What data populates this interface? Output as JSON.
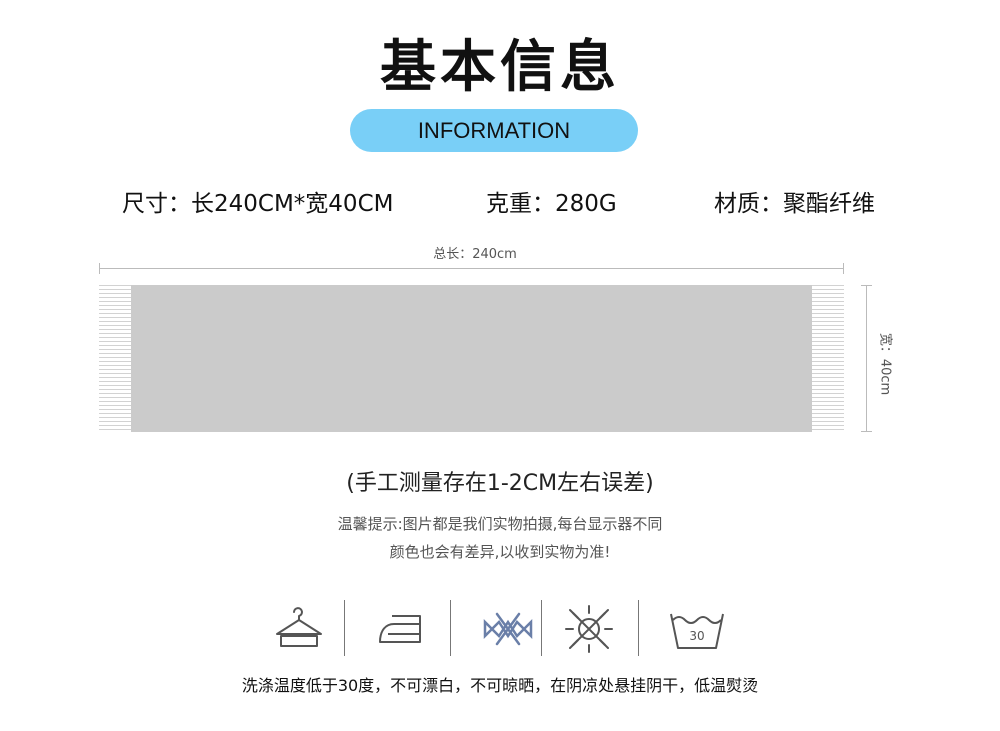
{
  "header": {
    "title": "基本信息",
    "subtitle": "INFORMATION",
    "pill_color": "#79cff7"
  },
  "specs": {
    "size": "尺寸：长240CM*宽40CM",
    "weight": "克重：280G",
    "material": "材质：聚酯纤维"
  },
  "diagram": {
    "length_label": "总长：240cm",
    "width_label": "宽：40cm"
  },
  "notes": {
    "measurement": "(手工测量存在1-2CM左右误差)",
    "tip_line1": "温馨提示:图片都是我们实物拍摄,每台显示器不同",
    "tip_line2": "颜色也会有差异,以收到实物为准!"
  },
  "care": {
    "icons": [
      "hanger-icon",
      "iron-icon",
      "no-wring-icon",
      "no-sun-icon",
      "wash-30-icon"
    ],
    "wash_temp_label": "30",
    "instructions": "洗涤温度低于30度，不可漂白，不可晾晒，在阴凉处悬挂阴干，低温熨烫"
  }
}
